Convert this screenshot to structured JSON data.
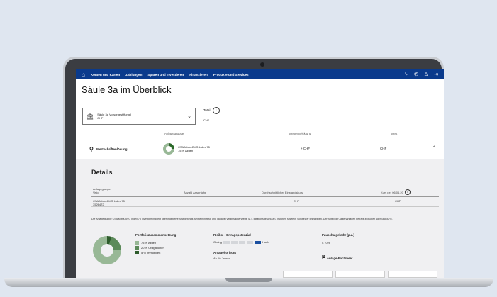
{
  "nav": {
    "items": [
      "Konten und Karten",
      "Zahlungen",
      "Sparen und Investieren",
      "Finanzieren",
      "Produkte und Services"
    ]
  },
  "page": {
    "title": "Säule 3a im Überblick"
  },
  "account": {
    "name": "Säule 3a Vorsorgestiftung I",
    "currency": "CHF"
  },
  "total": {
    "label": "Total",
    "currency": "CHF"
  },
  "table": {
    "headers": {
      "group": "Anlagegruppe",
      "change": "Wertentwicklung",
      "value": "Wert"
    },
    "row": {
      "label": "Wertschriftenlösung",
      "fund_name": "CSA Mixta-BVG Index 75",
      "fund_share": "75 % Aktien",
      "change": "+ CHF",
      "value": "CHF"
    }
  },
  "details": {
    "title": "Details",
    "headers": {
      "group": "Anlagegruppe",
      "valor": "Valor",
      "claims": "Anzahl Ansprüche",
      "avg_price": "Durchschnittlicher Einstandskurs",
      "price": "Kurs per 06.06.20"
    },
    "values": {
      "fund_name": "CSA Mixta-BVG Index 75",
      "valor": "3526472",
      "avg_price": "CHF",
      "price": "CHF"
    },
    "description": "Die Anlagegruppe CSA Mixta-BVG Index 75 investiert indirekt über indexierte Anlagefonds weltweit in fest- und variabel verzinsliche Werte (z.T. inflationsgeschützt), in Aktien sowie in Schweizer Immobilien. Der Anteil der Aktienanlagen beträgt zwischen 68% und 82%.",
    "portfolio": {
      "title": "Portfoliozusammensetzung",
      "legend": [
        {
          "label": "75 % Aktien",
          "color": "#98b896"
        },
        {
          "label": "20 % Obligationen",
          "color": "#5c8a5a"
        },
        {
          "label": "5 % Immobilien",
          "color": "#2e5c2c"
        }
      ]
    },
    "risk": {
      "title": "Risiko- / Ertragspotenzial",
      "low": "Gering",
      "high": "Hoch",
      "level": 5,
      "of": 5
    },
    "horizon": {
      "title": "Anlagehorizont",
      "value": "Ab 10 Jahren"
    },
    "fee": {
      "title": "Pauschalgebühr (p.a.)",
      "value": "0.70%"
    },
    "factsheet": "Anlage-Factsheet"
  }
}
